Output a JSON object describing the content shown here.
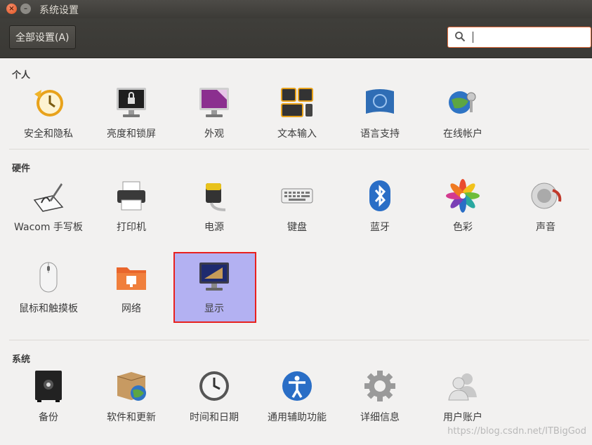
{
  "window": {
    "title": "系统设置"
  },
  "toolbar": {
    "all_settings_label": "全部设置(A)",
    "search_value": ""
  },
  "sections": {
    "personal": {
      "title": "个人",
      "items": [
        {
          "label": "安全和隐私",
          "icon": "clock-security-icon"
        },
        {
          "label": "亮度和锁屏",
          "icon": "monitor-lock-icon"
        },
        {
          "label": "外观",
          "icon": "appearance-monitor-icon"
        },
        {
          "label": "文本输入",
          "icon": "keyboard-keys-icon"
        },
        {
          "label": "语言支持",
          "icon": "language-flag-icon"
        },
        {
          "label": "在线帐户",
          "icon": "online-accounts-icon"
        }
      ]
    },
    "hardware": {
      "title": "硬件",
      "items": [
        {
          "label": "Wacom 手写板",
          "icon": "wacom-tablet-icon"
        },
        {
          "label": "打印机",
          "icon": "printer-icon"
        },
        {
          "label": "电源",
          "icon": "battery-power-icon"
        },
        {
          "label": "键盘",
          "icon": "keyboard-icon"
        },
        {
          "label": "蓝牙",
          "icon": "bluetooth-icon"
        },
        {
          "label": "色彩",
          "icon": "color-flower-icon"
        },
        {
          "label": "声音",
          "icon": "speaker-icon"
        },
        {
          "label": "鼠标和触摸板",
          "icon": "mouse-icon"
        },
        {
          "label": "网络",
          "icon": "network-folder-icon"
        },
        {
          "label": "显示",
          "icon": "display-monitor-icon"
        }
      ]
    },
    "system": {
      "title": "系统",
      "items": [
        {
          "label": "备份",
          "icon": "safe-backup-icon"
        },
        {
          "label": "软件和更新",
          "icon": "software-box-icon"
        },
        {
          "label": "时间和日期",
          "icon": "clock-icon"
        },
        {
          "label": "通用辅助功能",
          "icon": "accessibility-icon"
        },
        {
          "label": "详细信息",
          "icon": "gear-icon"
        },
        {
          "label": "用户账户",
          "icon": "users-icon"
        }
      ]
    }
  },
  "watermark": "https://blog.csdn.net/ITBigGod"
}
